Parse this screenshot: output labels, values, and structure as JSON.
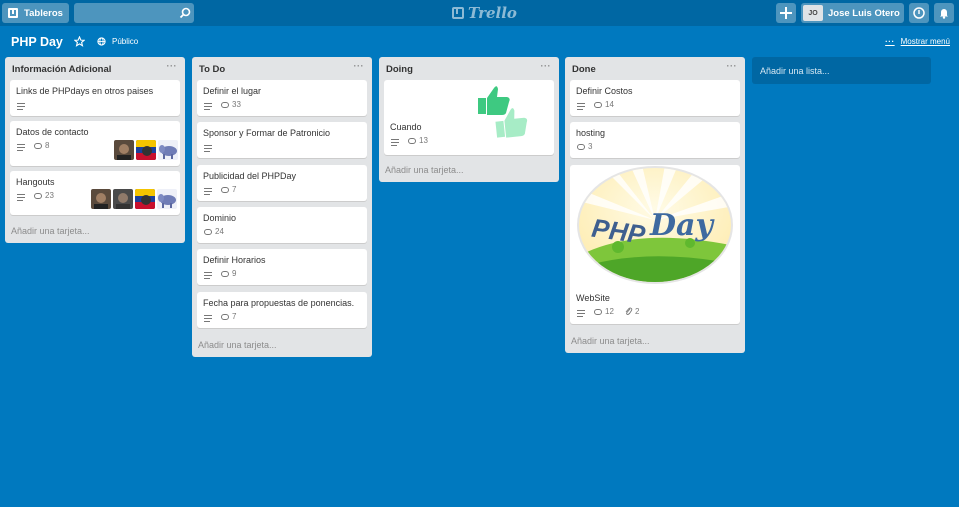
{
  "header": {
    "boards_label": "Tableros",
    "logo_text": "Trello",
    "user_initials": "JO",
    "user_name": "Jose Luis Otero"
  },
  "board": {
    "title": "PHP Day",
    "visibility": "Público",
    "menu_label": "Mostrar menú",
    "add_list_label": "Añadir una lista..."
  },
  "add_card_label": "Añadir una tarjeta...",
  "lists": [
    {
      "title": "Información Adicional",
      "cards": [
        {
          "title": "Links de PHPdays en otros paises"
        },
        {
          "title": "Datos de contacto",
          "comments": "8"
        },
        {
          "title": "Hangouts",
          "comments": "23"
        }
      ]
    },
    {
      "title": "To Do",
      "cards": [
        {
          "title": "Definir el lugar",
          "comments": "33"
        },
        {
          "title": "Sponsor y Formar de Patronicio"
        },
        {
          "title": "Publicidad del PHPDay",
          "comments": "7"
        },
        {
          "title": "Dominio",
          "comments": "24"
        },
        {
          "title": "Definir Horarios",
          "comments": "9"
        },
        {
          "title": "Fecha para propuestas de ponencias.",
          "comments": "7"
        }
      ]
    },
    {
      "title": "Doing",
      "cards": [
        {
          "title": "Cuando",
          "comments": "13"
        }
      ]
    },
    {
      "title": "Done",
      "cards": [
        {
          "title": "Definir Costos",
          "comments": "14"
        },
        {
          "title": "hosting",
          "comments": "3"
        },
        {
          "title": "WebSite",
          "comments": "12",
          "attachments": "2",
          "cover_text": "Day"
        }
      ]
    }
  ],
  "colors": {
    "board_bg": "#0079bf",
    "header_bg": "#0067a3",
    "list_bg": "#e2e4e6"
  }
}
